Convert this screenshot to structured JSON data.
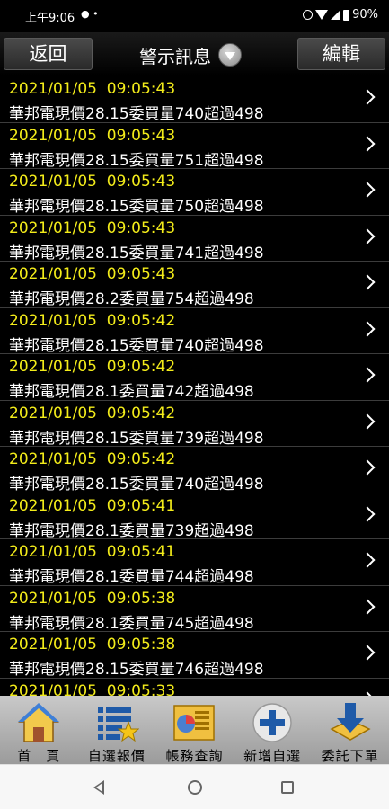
{
  "status_bar": {
    "time": "上午9:06",
    "battery": "90%"
  },
  "header": {
    "back_label": "返回",
    "title": "警示訊息",
    "edit_label": "編輯"
  },
  "alerts": [
    {
      "timestamp": "2021/01/05  09:05:43",
      "message": "華邦電現價28.15委買量740超過498"
    },
    {
      "timestamp": "2021/01/05  09:05:43",
      "message": "華邦電現價28.15委買量751超過498"
    },
    {
      "timestamp": "2021/01/05  09:05:43",
      "message": "華邦電現價28.15委買量750超過498"
    },
    {
      "timestamp": "2021/01/05  09:05:43",
      "message": "華邦電現價28.15委買量741超過498"
    },
    {
      "timestamp": "2021/01/05  09:05:43",
      "message": "華邦電現價28.2委買量754超過498"
    },
    {
      "timestamp": "2021/01/05  09:05:42",
      "message": "華邦電現價28.15委買量740超過498"
    },
    {
      "timestamp": "2021/01/05  09:05:42",
      "message": "華邦電現價28.1委買量742超過498"
    },
    {
      "timestamp": "2021/01/05  09:05:42",
      "message": "華邦電現價28.15委買量739超過498"
    },
    {
      "timestamp": "2021/01/05  09:05:42",
      "message": "華邦電現價28.15委買量740超過498"
    },
    {
      "timestamp": "2021/01/05  09:05:41",
      "message": "華邦電現價28.1委買量739超過498"
    },
    {
      "timestamp": "2021/01/05  09:05:41",
      "message": "華邦電現價28.1委買量744超過498"
    },
    {
      "timestamp": "2021/01/05  09:05:38",
      "message": "華邦電現價28.1委買量745超過498"
    },
    {
      "timestamp": "2021/01/05  09:05:38",
      "message": "華邦電現價28.15委買量746超過498"
    },
    {
      "timestamp": "2021/01/05  09:05:33",
      "message": ""
    }
  ],
  "bottom_nav": [
    {
      "label": "首　頁",
      "icon": "home-icon"
    },
    {
      "label": "自選報價",
      "icon": "watchlist-icon"
    },
    {
      "label": "帳務查詢",
      "icon": "account-query-icon"
    },
    {
      "label": "新增自選",
      "icon": "add-watchlist-icon"
    },
    {
      "label": "委託下單",
      "icon": "place-order-icon"
    }
  ],
  "colors": {
    "timestamp": "#f3ec1a",
    "message": "#ffffff",
    "background": "#000000"
  }
}
